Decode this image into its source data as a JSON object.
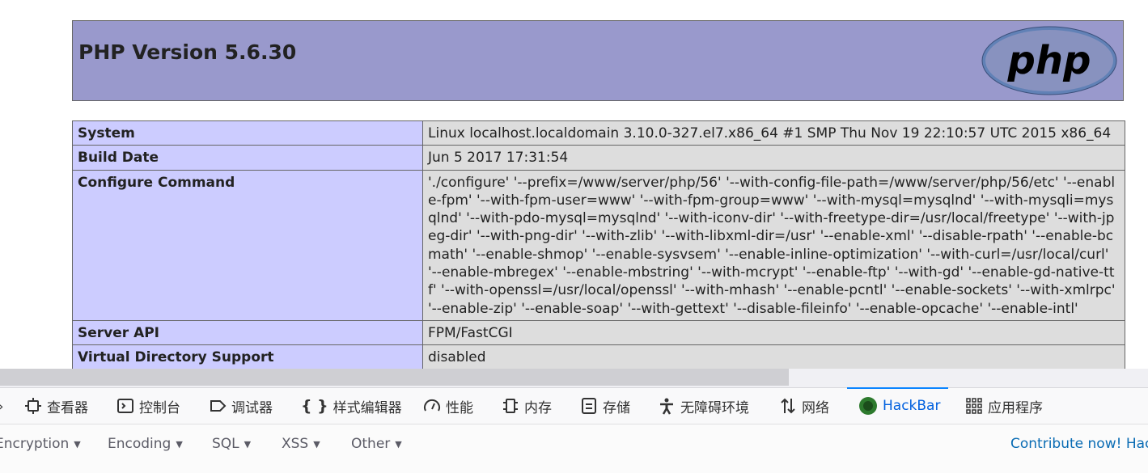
{
  "header": {
    "title": "PHP Version 5.6.30",
    "logo_text": "php"
  },
  "info_table": {
    "rows": [
      {
        "key": "System",
        "value": "Linux localhost.localdomain 3.10.0-327.el7.x86_64 #1 SMP Thu Nov 19 22:10:57 UTC 2015 x86_64"
      },
      {
        "key": "Build Date",
        "value": "Jun 5 2017 17:31:54"
      },
      {
        "key": "Configure Command",
        "value": "'./configure' '--prefix=/www/server/php/56' '--with-config-file-path=/www/server/php/56/etc' '--enable-fpm' '--with-fpm-user=www' '--with-fpm-group=www' '--with-mysql=mysqlnd' '--with-mysqli=mysqlnd' '--with-pdo-mysql=mysqlnd' '--with-iconv-dir' '--with-freetype-dir=/usr/local/freetype' '--with-jpeg-dir' '--with-png-dir' '--with-zlib' '--with-libxml-dir=/usr' '--enable-xml' '--disable-rpath' '--enable-bcmath' '--enable-shmop' '--enable-sysvsem' '--enable-inline-optimization' '--with-curl=/usr/local/curl' '--enable-mbregex' '--enable-mbstring' '--with-mcrypt' '--enable-ftp' '--with-gd' '--enable-gd-native-ttf' '--with-openssl=/usr/local/openssl' '--with-mhash' '--enable-pcntl' '--enable-sockets' '--with-xmlrpc' '--enable-zip' '--enable-soap' '--with-gettext' '--disable-fileinfo' '--enable-opcache' '--enable-intl'"
      },
      {
        "key": "Server API",
        "value": "FPM/FastCGI"
      },
      {
        "key": "Virtual Directory Support",
        "value": "disabled"
      }
    ]
  },
  "devtools": {
    "tabs": [
      {
        "label": "查看器",
        "icon": "inspector-icon"
      },
      {
        "label": "控制台",
        "icon": "console-icon"
      },
      {
        "label": "调试器",
        "icon": "debugger-icon"
      },
      {
        "label": "样式编辑器",
        "icon": "style-editor-icon"
      },
      {
        "label": "性能",
        "icon": "performance-icon"
      },
      {
        "label": "内存",
        "icon": "memory-icon"
      },
      {
        "label": "存储",
        "icon": "storage-icon"
      },
      {
        "label": "无障碍环境",
        "icon": "accessibility-icon"
      },
      {
        "label": "网络",
        "icon": "network-icon"
      },
      {
        "label": "HackBar",
        "icon": "hackbar-icon",
        "active": true
      },
      {
        "label": "应用程序",
        "icon": "application-icon"
      }
    ],
    "accent_color": "#0a84ff"
  },
  "hackbar": {
    "menus": [
      "Encryption",
      "Encoding",
      "SQL",
      "XSS",
      "Other"
    ],
    "contribute": "Contribute now! Hac"
  }
}
